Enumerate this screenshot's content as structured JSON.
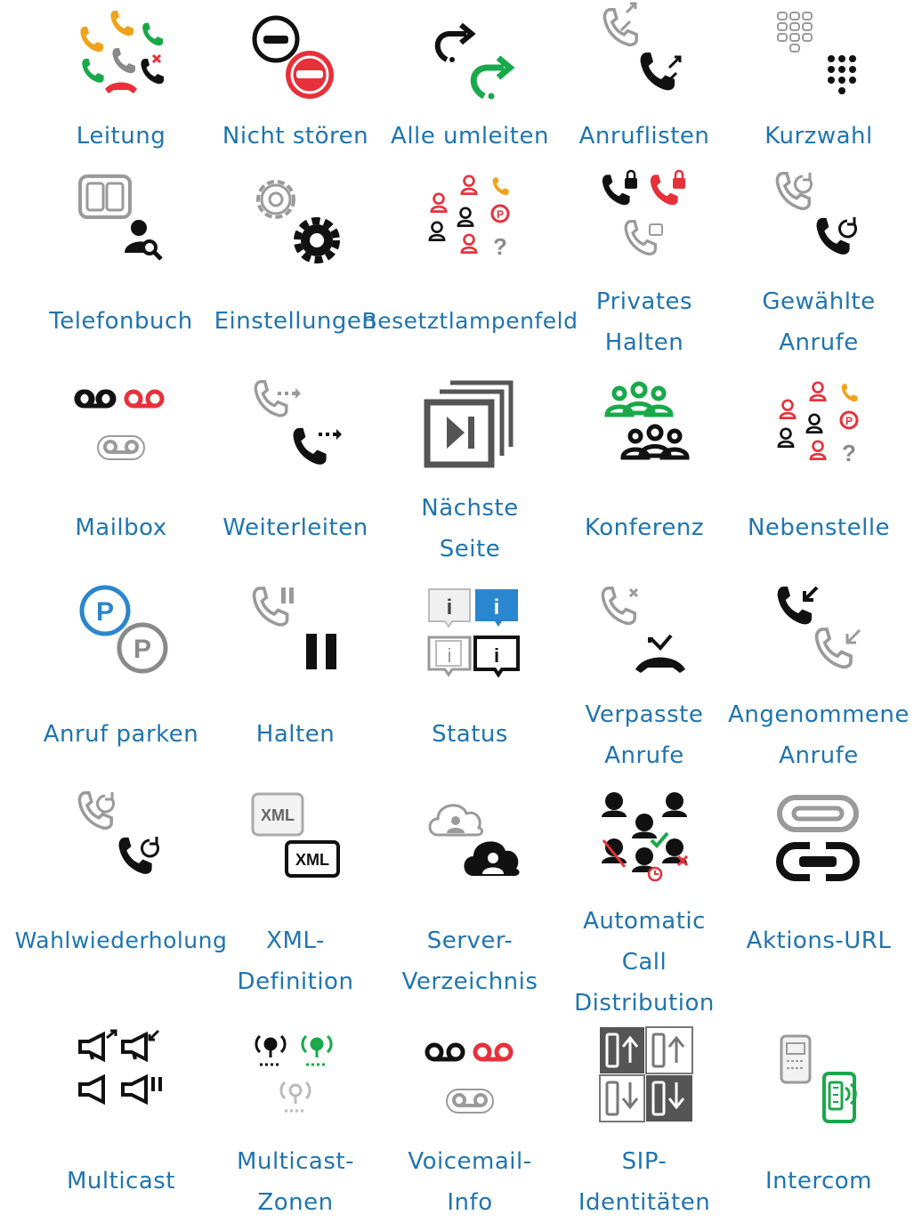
{
  "rows": [
    [
      {
        "label_lines": [
          "Leitung"
        ],
        "icon": "line-keys-icon"
      },
      {
        "label_lines": [
          "Nicht stören"
        ],
        "icon": "do-not-disturb-icon"
      },
      {
        "label_lines": [
          "Alle umleiten"
        ],
        "icon": "forward-all-icon"
      },
      {
        "label_lines": [
          "Anruflisten"
        ],
        "icon": "call-lists-icon"
      },
      {
        "label_lines": [
          "Kurzwahl"
        ],
        "icon": "speed-dial-icon"
      }
    ],
    [
      {
        "label_lines": [
          "Telefonbuch"
        ],
        "icon": "phonebook-icon"
      },
      {
        "label_lines": [
          "Einstellungen"
        ],
        "icon": "settings-icon"
      },
      {
        "label_lines": [
          "Besetztlampenfeld"
        ],
        "icon": "busy-lamp-field-icon"
      },
      {
        "label_lines": [
          "Privates",
          "Halten"
        ],
        "icon": "private-hold-icon"
      },
      {
        "label_lines": [
          "Gewählte",
          "Anrufe"
        ],
        "icon": "dialed-calls-icon"
      }
    ],
    [
      {
        "label_lines": [
          "Mailbox"
        ],
        "icon": "mailbox-icon"
      },
      {
        "label_lines": [
          "Weiterleiten"
        ],
        "icon": "transfer-icon"
      },
      {
        "label_lines": [
          "Nächste",
          "Seite"
        ],
        "icon": "next-page-icon"
      },
      {
        "label_lines": [
          "Konferenz"
        ],
        "icon": "conference-icon"
      },
      {
        "label_lines": [
          "Nebenstelle"
        ],
        "icon": "extension-icon"
      }
    ],
    [
      {
        "label_lines": [
          "Anruf parken"
        ],
        "icon": "call-park-icon"
      },
      {
        "label_lines": [
          "Halten"
        ],
        "icon": "hold-icon"
      },
      {
        "label_lines": [
          "Status"
        ],
        "icon": "status-icon"
      },
      {
        "label_lines": [
          "Verpasste",
          "Anrufe"
        ],
        "icon": "missed-calls-icon"
      },
      {
        "label_lines": [
          "Angenommene",
          "Anrufe"
        ],
        "icon": "received-calls-icon"
      }
    ],
    [
      {
        "label_lines": [
          "Wahlwiederholung"
        ],
        "icon": "redial-icon"
      },
      {
        "label_lines": [
          "XML-",
          "Definition"
        ],
        "icon": "xml-definition-icon",
        "text_top": "XML",
        "text_bottom": "XML"
      },
      {
        "label_lines": [
          "Server-",
          "Verzeichnis"
        ],
        "icon": "server-directory-icon"
      },
      {
        "label_lines": [
          "Automatic",
          "Call",
          "Distribution"
        ],
        "icon": "acd-icon"
      },
      {
        "label_lines": [
          "Aktions-URL"
        ],
        "icon": "action-url-icon"
      }
    ],
    [
      {
        "label_lines": [
          "Multicast"
        ],
        "icon": "multicast-icon"
      },
      {
        "label_lines": [
          "Multicast-",
          "Zonen"
        ],
        "icon": "multicast-zones-icon"
      },
      {
        "label_lines": [
          "Voicemail-",
          "Info"
        ],
        "icon": "voicemail-info-icon"
      },
      {
        "label_lines": [
          "SIP-",
          "Identitäten"
        ],
        "icon": "sip-identities-icon"
      },
      {
        "label_lines": [
          "Intercom"
        ],
        "icon": "intercom-icon"
      }
    ]
  ],
  "colors": {
    "label": "#1f74b1",
    "black": "#111111",
    "grey": "#8a8a8a",
    "red": "#e8303a",
    "green": "#19a84a",
    "orange": "#f0a21a",
    "blue": "#2a86cf"
  }
}
